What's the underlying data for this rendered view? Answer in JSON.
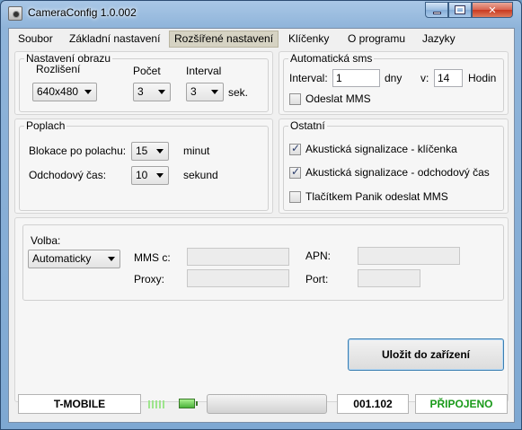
{
  "window": {
    "title": "CameraConfig 1.0.002"
  },
  "menu": {
    "items": [
      {
        "label": "Soubor"
      },
      {
        "label": "Základní nastavení"
      },
      {
        "label": "Rozšířené nastavení"
      },
      {
        "label": "Klíčenky"
      },
      {
        "label": "O programu"
      },
      {
        "label": "Jazyky"
      }
    ],
    "active": "Rozšířené nastavení"
  },
  "image_settings": {
    "title": "Nastavení obrazu",
    "resolution_label": "Rozlišení",
    "resolution_value": "640x480",
    "count_label": "Počet",
    "count_value": "3",
    "interval_label": "Interval",
    "interval_value": "3",
    "interval_unit": "sek."
  },
  "auto_sms": {
    "title": "Automatická sms",
    "interval_label": "Interval:",
    "interval_value": "1",
    "days_label": "dny",
    "at_label": "v:",
    "hour_value": "14",
    "hours_label": "Hodin",
    "send_mms_label": "Odeslat MMS",
    "send_mms_checked": false
  },
  "alarm": {
    "title": "Poplach",
    "block_label": "Blokace po polachu:",
    "block_value": "15",
    "block_unit": "minut",
    "exit_label": "Odchodový čas:",
    "exit_value": "10",
    "exit_unit": "sekund"
  },
  "other": {
    "title": "Ostatní",
    "options": [
      {
        "label": "Akustická signalizace - klíčenka",
        "checked": true
      },
      {
        "label": "Akustická signalizace - odchodový čas",
        "checked": true
      },
      {
        "label": "Tlačítkem Panik odeslat MMS",
        "checked": false
      }
    ]
  },
  "mms": {
    "choice_label": "Volba:",
    "choice_value": "Automaticky",
    "mmsc_label": "MMS c:",
    "mmsc_value": "",
    "proxy_label": "Proxy:",
    "proxy_value": "",
    "apn_label": "APN:",
    "apn_value": "",
    "port_label": "Port:",
    "port_value": ""
  },
  "save_button": {
    "label": "Uložit do zařízení"
  },
  "status": {
    "operator": "T-MOBILE",
    "signal_level": 0.5,
    "battery_level": 1.0,
    "version": "001.102",
    "connection": "PŘIPOJENO",
    "connection_color": "#1a9a1a"
  },
  "colors": {
    "titlebar": "#8fb4da",
    "client_bg": "#f0f0f0",
    "panel_bg": "#f6f6f6",
    "close_button": "#c8391f"
  }
}
